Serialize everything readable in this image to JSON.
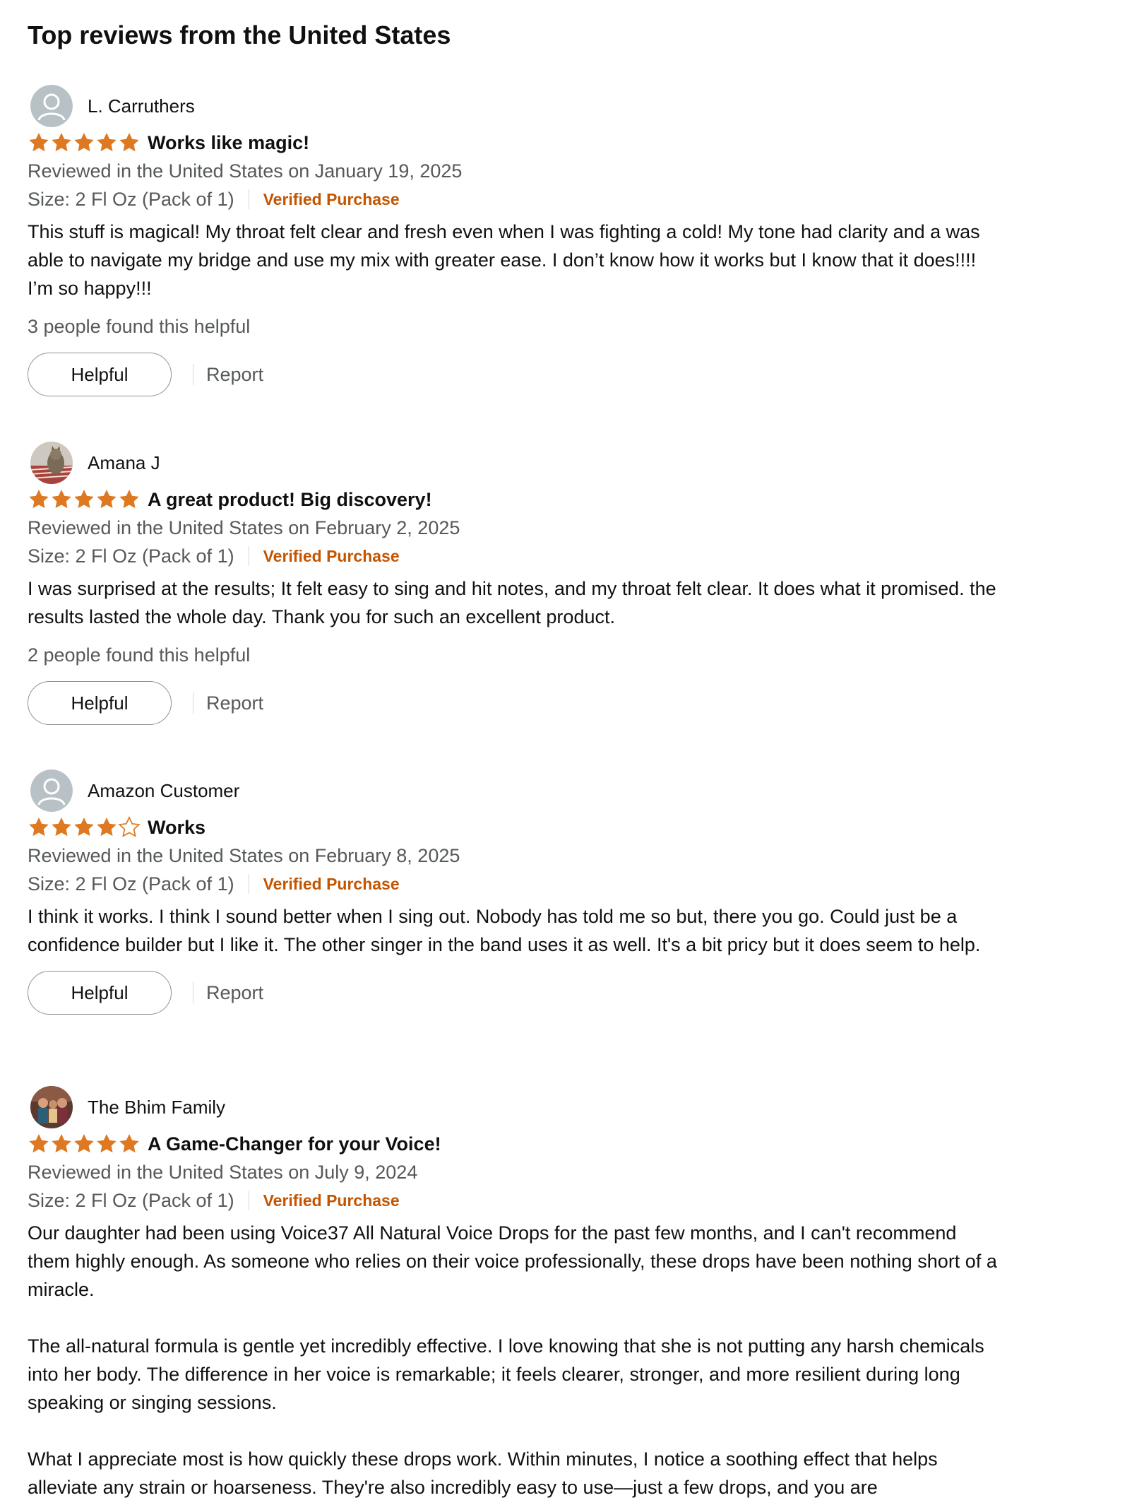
{
  "section_title": "Top reviews from the United States",
  "colors": {
    "star": "#de7921",
    "verified": "#c45500",
    "muted_text": "#565959"
  },
  "reviews": [
    {
      "reviewer": "L. Carruthers",
      "avatar": "default-avatar",
      "rating": 5,
      "title": "Works like magic!",
      "date": "Reviewed in the United States on January 19, 2025",
      "size": "Size: 2 Fl Oz (Pack of 1)",
      "verified": "Verified Purchase",
      "body": "This stuff is magical! My throat felt clear and fresh even when I was fighting a cold! My tone had clarity and a was able to navigate my bridge and use my mix with greater ease. I don’t know how it works but I know that it does!!!! I’m so happy!!!",
      "helpful_count": "3 people found this helpful",
      "helpful_label": "Helpful",
      "report_label": "Report"
    },
    {
      "reviewer": "Amana J",
      "avatar": "photo-avatar-cat",
      "rating": 5,
      "title": "A great product! Big discovery!",
      "date": "Reviewed in the United States on February 2, 2025",
      "size": "Size: 2 Fl Oz (Pack of 1)",
      "verified": "Verified Purchase",
      "body": "I was surprised at the results; It felt easy to sing and hit notes, and my throat felt clear. It does what it promised. the results lasted the whole day. Thank you for such an excellent product.",
      "helpful_count": "2 people found this helpful",
      "helpful_label": "Helpful",
      "report_label": "Report"
    },
    {
      "reviewer": "Amazon Customer",
      "avatar": "default-avatar",
      "rating": 4,
      "title": "Works",
      "date": "Reviewed in the United States on February 8, 2025",
      "size": "Size: 2 Fl Oz (Pack of 1)",
      "verified": "Verified Purchase",
      "body": "I think it works. I think I sound better when I sing out. Nobody has told me so but, there you go. Could just be a confidence builder but I like it. The other singer in the band uses it as well. It's a bit pricy but it does seem to help.",
      "helpful_label": "Helpful",
      "report_label": "Report"
    },
    {
      "reviewer": "The Bhim Family",
      "avatar": "photo-avatar-family",
      "rating": 5,
      "title": "A Game-Changer for your Voice!",
      "date": "Reviewed in the United States on July 9, 2024",
      "size": "Size: 2 Fl Oz (Pack of 1)",
      "verified": "Verified Purchase",
      "body": "Our daughter had been using Voice37 All Natural Voice Drops for the past few months, and I can't recommend them highly enough. As someone who relies on their voice professionally, these drops have been nothing short of a miracle.\n\nThe all-natural formula is gentle yet incredibly effective. I love knowing that she is not putting any harsh chemicals into her body. The difference in her voice is remarkable; it feels clearer, stronger, and more resilient during long speaking or singing sessions.\n\nWhat I appreciate most is how quickly these drops work. Within minutes, I notice a soothing effect that helps alleviate any strain or hoarseness. They're also incredibly easy to use—just a few drops, and you are"
    }
  ]
}
